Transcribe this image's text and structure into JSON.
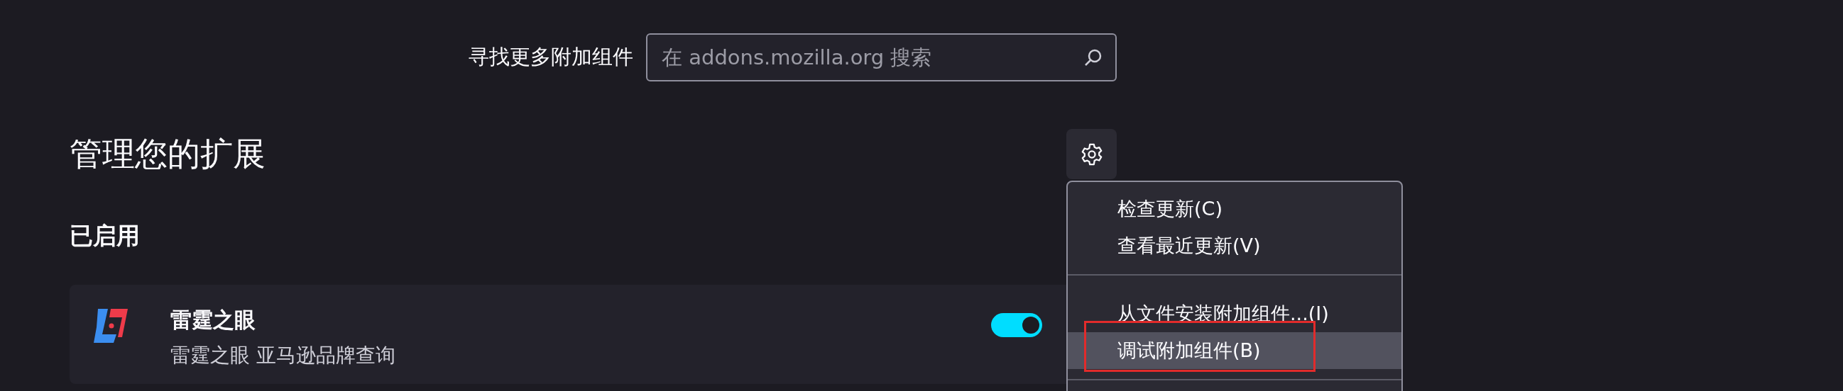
{
  "search": {
    "label": "寻找更多附加组件",
    "placeholder": "在 addons.mozilla.org 搜索"
  },
  "heading": "管理您的扩展",
  "section_title": "已启用",
  "extensions": [
    {
      "name": "雷霆之眼",
      "description": "雷霆之眼 亚马逊品牌查询",
      "on": true
    }
  ],
  "menu": {
    "groups": [
      [
        {
          "label": "检查更新(C)",
          "highlighted": false,
          "annotated": false
        },
        {
          "label": "查看最近更新(V)",
          "highlighted": false,
          "annotated": false
        }
      ],
      [
        {
          "label": "从文件安装附加组件...(I)",
          "highlighted": false,
          "annotated": false
        },
        {
          "label": "调试附加组件(B)",
          "highlighted": true,
          "annotated": true
        }
      ]
    ],
    "separator_below": true
  }
}
